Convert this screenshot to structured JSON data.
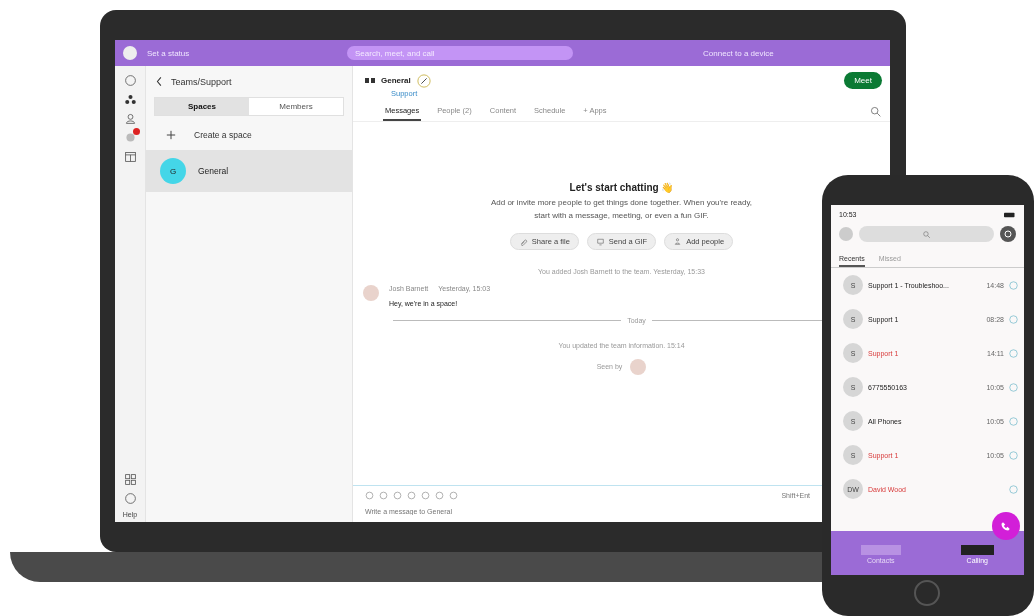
{
  "topbar": {
    "status": "Set a status",
    "search_placeholder": "Search, meet, and call",
    "connect": "Connect to a device"
  },
  "rail": {
    "badge": true,
    "help": "Help"
  },
  "panel": {
    "title": "Teams/Support",
    "tabs": [
      {
        "label": "Spaces",
        "selected": true
      },
      {
        "label": "Members",
        "selected": false
      }
    ],
    "create": "Create a space",
    "spaces": [
      {
        "initial": "G",
        "name": "General",
        "selected": true
      }
    ]
  },
  "header": {
    "title": "General",
    "subtitle": "Support",
    "meet": "Meet",
    "tabs": [
      {
        "label": "Messages",
        "selected": true
      },
      {
        "label": "People (2)",
        "selected": false
      },
      {
        "label": "Content",
        "selected": false
      },
      {
        "label": "Schedule",
        "selected": false
      },
      {
        "label": "+ Apps",
        "selected": false
      }
    ]
  },
  "welcome": {
    "title": "Let's start chatting 👋",
    "text": "Add or invite more people to get things done together. When you're ready, start with a message, meeting, or even a fun GIF.",
    "actions": [
      {
        "kind": "file",
        "label": "Share a file"
      },
      {
        "kind": "gif",
        "label": "Send a GIF"
      },
      {
        "kind": "people",
        "label": "Add people"
      }
    ]
  },
  "events": [
    {
      "kind": "system",
      "text": "You added Josh Barnett to the team. Yesterday, 15:33"
    },
    {
      "kind": "message",
      "author": "Josh Barnett",
      "time": "Yesterday, 15:03",
      "text": "Hey, we're in a space!"
    },
    {
      "kind": "divider",
      "text": "Today"
    },
    {
      "kind": "system",
      "text": "You updated the team information. 15:14"
    },
    {
      "kind": "seen",
      "text": "Seen by"
    }
  ],
  "composer": {
    "placeholder": "Write a message to General",
    "hint": "Shift+Ent"
  },
  "phone": {
    "time": "10:53",
    "tabs": [
      {
        "label": "Recents",
        "selected": true
      },
      {
        "label": "Missed",
        "selected": false
      }
    ],
    "calls": [
      {
        "initial": "S",
        "name": "Support 1 - Troubleshoo...",
        "missed": false,
        "time": "14:48"
      },
      {
        "initial": "S",
        "name": "Support 1",
        "missed": false,
        "time": "08:28"
      },
      {
        "initial": "S",
        "name": "Support 1",
        "missed": true,
        "time": "14:11"
      },
      {
        "initial": "S",
        "name": "6775550163",
        "missed": false,
        "time": "10:05"
      },
      {
        "initial": "S",
        "name": "All Phones",
        "missed": false,
        "time": "10:05"
      },
      {
        "initial": "S",
        "name": "Support 1",
        "missed": true,
        "time": "10:05"
      },
      {
        "initial": "DW",
        "name": "David Wood",
        "missed": true
      }
    ],
    "nav": [
      {
        "label": "Contacts",
        "selected": false
      },
      {
        "label": "Calling",
        "selected": true
      }
    ]
  }
}
